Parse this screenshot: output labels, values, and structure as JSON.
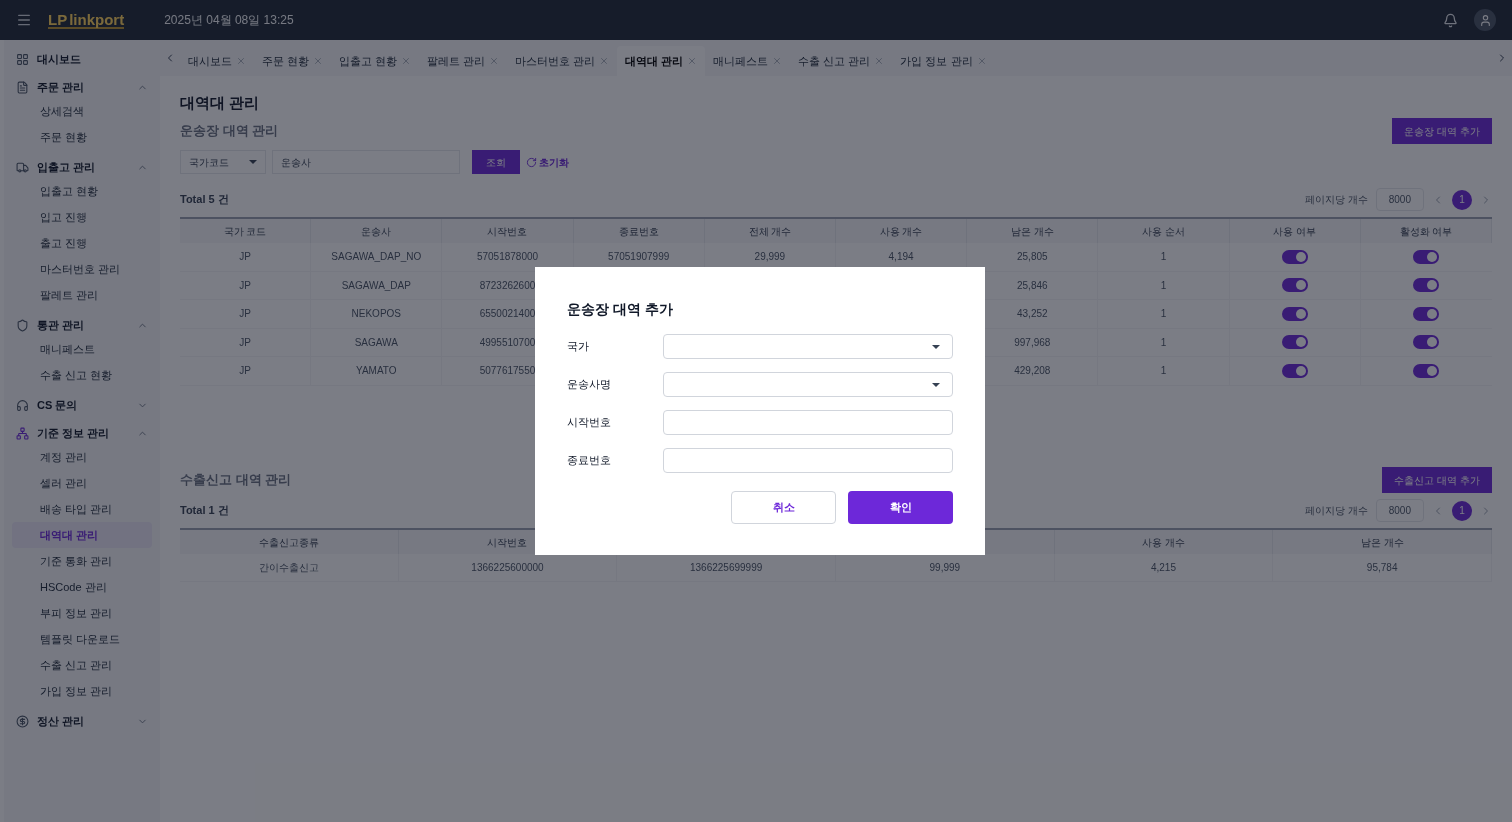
{
  "header": {
    "logo": "linkport",
    "logo_mark": "LP",
    "datetime": "2025년 04월 08일 13:25"
  },
  "sidebar": {
    "items": [
      {
        "label": "대시보드"
      },
      {
        "label": "주문 관리",
        "expanded": true,
        "children": [
          {
            "label": "상세검색",
            "selected": false
          },
          {
            "label": "주문 현황",
            "selected": false
          }
        ]
      },
      {
        "label": "입출고 관리",
        "expanded": true,
        "children": [
          {
            "label": "입출고 현황",
            "selected": false
          },
          {
            "label": "입고 진행",
            "selected": false
          },
          {
            "label": "출고 진행",
            "selected": false
          },
          {
            "label": "마스터번호 관리",
            "selected": false
          },
          {
            "label": "팔레트 관리",
            "selected": false
          }
        ]
      },
      {
        "label": "통관 관리",
        "expanded": true,
        "children": [
          {
            "label": "매니페스트",
            "selected": false
          },
          {
            "label": "수출 신고 현황",
            "selected": false
          }
        ]
      },
      {
        "label": "CS 문의",
        "expanded": false
      },
      {
        "label": "기준 정보 관리",
        "expanded": true,
        "children": [
          {
            "label": "계정 관리",
            "selected": false
          },
          {
            "label": "셀러 관리",
            "selected": false
          },
          {
            "label": "배송 타입 관리",
            "selected": false
          },
          {
            "label": "대역대 관리",
            "selected": true
          },
          {
            "label": "기준 통화 관리",
            "selected": false
          },
          {
            "label": "HSCode 관리",
            "selected": false
          },
          {
            "label": "부피 정보 관리",
            "selected": false
          },
          {
            "label": "템플릿 다운로드",
            "selected": false
          },
          {
            "label": "수출 신고 관리",
            "selected": false
          },
          {
            "label": "가입 정보 관리",
            "selected": false
          }
        ]
      },
      {
        "label": "정산 관리",
        "expanded": false
      }
    ]
  },
  "tabs": [
    {
      "label": "대시보드",
      "selected": false
    },
    {
      "label": "주문 현황",
      "selected": false
    },
    {
      "label": "입출고 현황",
      "selected": false
    },
    {
      "label": "팔레트 관리",
      "selected": false
    },
    {
      "label": "마스터번호 관리",
      "selected": false
    },
    {
      "label": "대역대 관리",
      "selected": true
    },
    {
      "label": "매니페스트",
      "selected": false
    },
    {
      "label": "수출 신고 관리",
      "selected": false
    },
    {
      "label": "가입 정보 관리",
      "selected": false
    }
  ],
  "page_title": "대역대 관리",
  "waybill_section": {
    "title": "운송장 대역 관리",
    "add_button": "운송장 대역 추가",
    "filters": {
      "country_placeholder": "국가코드",
      "carrier_placeholder": "운송사",
      "search_button": "조회",
      "reset_button": "초기화"
    },
    "total": "Total 5 건",
    "per_page_label": "페이지당 개수",
    "per_page": "8000",
    "pages": [
      {
        "label": "1",
        "selected": true
      }
    ],
    "columns": [
      "국가 코드",
      "운송사",
      "시작번호",
      "종료번호",
      "전체 개수",
      "사용 개수",
      "남은 개수",
      "사용 순서",
      "사용 여부",
      "활성화 여부"
    ],
    "rows": [
      {
        "cells": [
          "JP",
          "SAGAWA_DAP_NO",
          "57051878000",
          "57051907999",
          "29,999",
          "4,194",
          "25,805",
          "1"
        ],
        "in_use": true,
        "active": true
      },
      {
        "cells": [
          "JP",
          "SAGAWA_DAP",
          "8723262600",
          null,
          null,
          null,
          "25,846",
          "1"
        ],
        "in_use": true,
        "active": true
      },
      {
        "cells": [
          "JP",
          "NEKOPOS",
          "6550021400",
          null,
          null,
          null,
          "43,252",
          "1"
        ],
        "in_use": true,
        "active": true
      },
      {
        "cells": [
          "JP",
          "SAGAWA",
          "4995510700",
          null,
          null,
          null,
          "997,968",
          "1"
        ],
        "in_use": true,
        "active": true
      },
      {
        "cells": [
          "JP",
          "YAMATO",
          "5077617550",
          null,
          null,
          null,
          "429,208",
          "1"
        ],
        "in_use": true,
        "active": true
      }
    ]
  },
  "export_section": {
    "title": "수출신고 대역 관리",
    "add_button": "수출신고 대역 추가",
    "total": "Total 1 건",
    "per_page_label": "페이지당 개수",
    "per_page": "8000",
    "pages": [
      {
        "label": "1",
        "selected": true
      }
    ],
    "columns": [
      "수출신고종류",
      "시작번호",
      null,
      null,
      "사용 개수",
      "남은 개수"
    ],
    "rows": [
      {
        "cells": [
          "간이수출신고",
          "1366225600000",
          "1366225699999",
          "99,999",
          "4,215",
          "95,784"
        ]
      }
    ]
  },
  "dialog": {
    "title": "운송장 대역 추가",
    "fields": [
      {
        "kind": "select",
        "label": "국가"
      },
      {
        "kind": "select",
        "label": "운송사명"
      },
      {
        "kind": "input",
        "label": "시작번호"
      },
      {
        "kind": "input",
        "label": "종료번호"
      }
    ],
    "cancel": "취소",
    "confirm": "확인"
  }
}
